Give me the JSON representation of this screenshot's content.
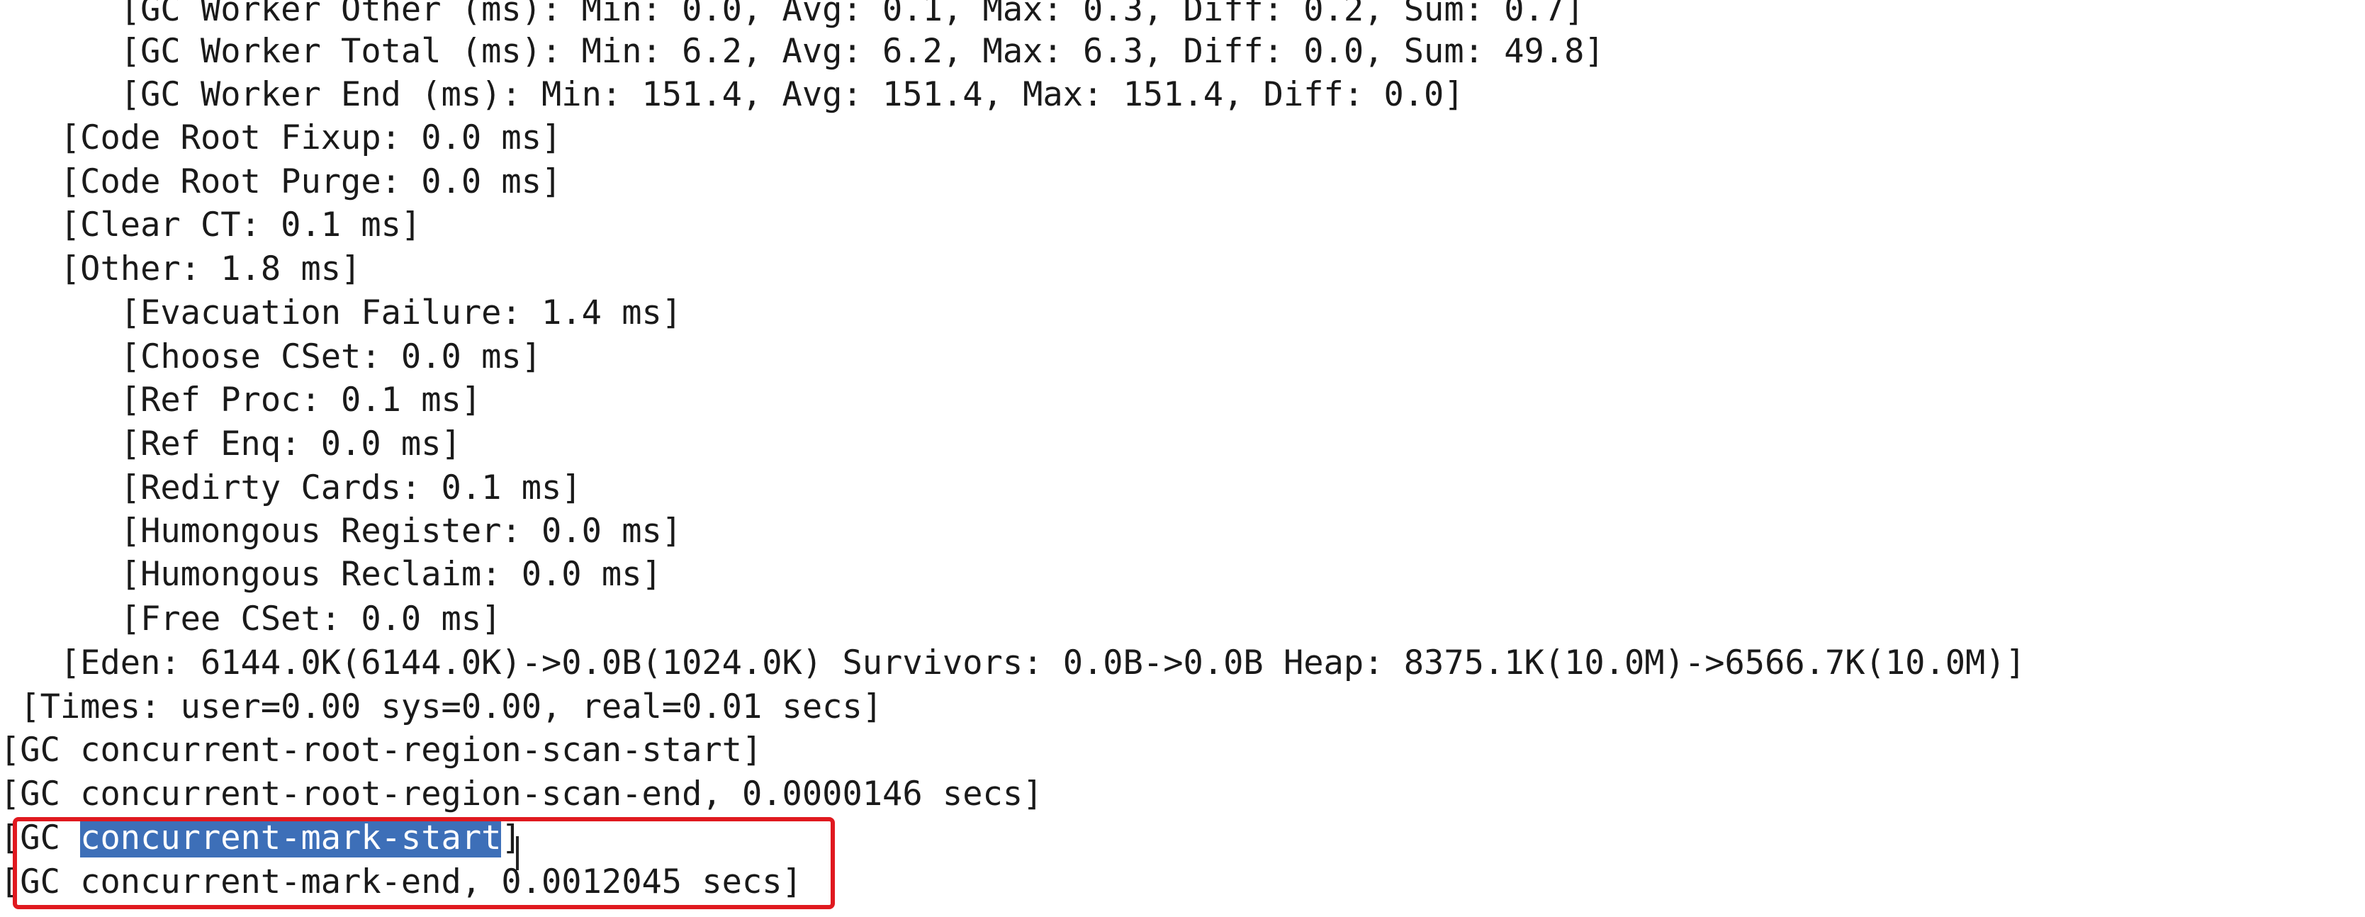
{
  "log": {
    "lines": [
      "      [GC Worker Other (ms): Min: 0.0, Avg: 0.1, Max: 0.3, Diff: 0.2, Sum: 0.7]",
      "      [GC Worker Total (ms): Min: 6.2, Avg: 6.2, Max: 6.3, Diff: 0.0, Sum: 49.8]",
      "      [GC Worker End (ms): Min: 151.4, Avg: 151.4, Max: 151.4, Diff: 0.0]",
      "   [Code Root Fixup: 0.0 ms]",
      "   [Code Root Purge: 0.0 ms]",
      "   [Clear CT: 0.1 ms]",
      "   [Other: 1.8 ms]",
      "      [Evacuation Failure: 1.4 ms]",
      "      [Choose CSet: 0.0 ms]",
      "      [Ref Proc: 0.1 ms]",
      "      [Ref Enq: 0.0 ms]",
      "      [Redirty Cards: 0.1 ms]",
      "      [Humongous Register: 0.0 ms]",
      "      [Humongous Reclaim: 0.0 ms]",
      "      [Free CSet: 0.0 ms]",
      "   [Eden: 6144.0K(6144.0K)->0.0B(1024.0K) Survivors: 0.0B->0.0B Heap: 8375.1K(10.0M)->6566.7K(10.0M)]",
      " [Times: user=0.00 sys=0.00, real=0.01 secs]",
      "[GC concurrent-root-region-scan-start]",
      "[GC concurrent-root-region-scan-end, 0.0000146 secs]",
      "[GC concurrent-mark-end, 0.0012045 secs]"
    ],
    "mark_start": {
      "prefix": "[GC ",
      "selected": "concurrent-mark-start",
      "suffix": "]"
    }
  }
}
